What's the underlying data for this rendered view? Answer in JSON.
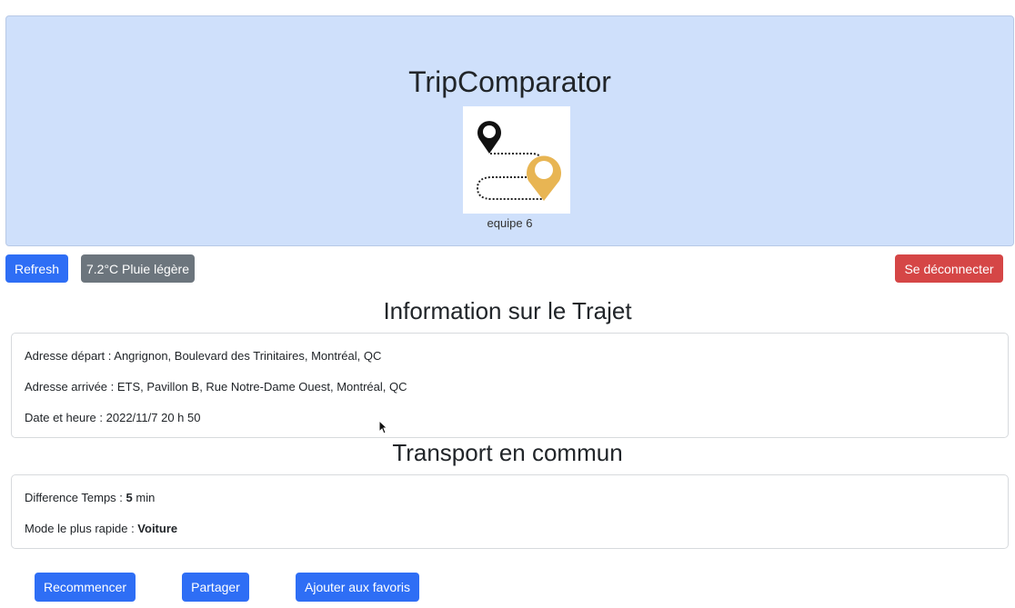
{
  "header": {
    "title": "TripComparator",
    "team": "equipe 6",
    "logo_icon": "route-map-pins-icon"
  },
  "toolbar": {
    "refresh_label": "Refresh",
    "weather_label": "7.2°C Pluie légère",
    "logout_label": "Se déconnecter"
  },
  "trip_info": {
    "title": "Information sur le Trajet",
    "departure_label": "Adresse départ : ",
    "departure_value": "Angrignon, Boulevard des Trinitaires, Montréal, QC",
    "arrival_label": "Adresse arrivée : ",
    "arrival_value": "ETS, Pavillon B, Rue Notre-Dame Ouest, Montréal, QC",
    "datetime_label": "Date et heure : ",
    "datetime_value": "2022/11/7 20 h 50"
  },
  "transport": {
    "title": "Transport en commun",
    "time_diff_label": "Difference Temps : ",
    "time_diff_value": "5",
    "time_diff_unit": " min",
    "fastest_label": "Mode le plus rapide : ",
    "fastest_value": "Voiture"
  },
  "actions": {
    "restart_label": "Recommencer",
    "share_label": "Partager",
    "favorite_label": "Ajouter aux favoris"
  },
  "colors": {
    "header_bg": "#cfe0fb",
    "primary": "#2e6ef5",
    "secondary": "#6c757d",
    "danger": "#d54646",
    "pin_gold": "#e8b553"
  }
}
